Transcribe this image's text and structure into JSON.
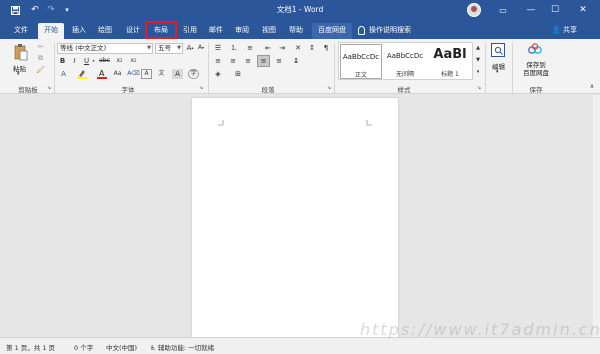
{
  "titlebar": {
    "title": "文档1 - Word",
    "save_icon": "save-icon",
    "undo_icon": "undo-icon",
    "redo_icon": "redo-icon",
    "qat_icon": "customize-qat-icon",
    "window_buttons": [
      "minimize",
      "restore",
      "close"
    ],
    "restore_ribbon_icon": "ribbon-display-icon"
  },
  "tabs": {
    "file": "文件",
    "home": "开始",
    "insert": "插入",
    "draw": "绘图",
    "design": "设计",
    "layout": "布局",
    "references": "引用",
    "mailings": "邮件",
    "review": "审阅",
    "view": "视图",
    "help": "帮助",
    "baidu": "百度网盘",
    "tellme": "操作说明搜索",
    "share": "共享"
  },
  "ribbon": {
    "clipboard": {
      "paste": "粘贴",
      "label": "剪贴板"
    },
    "font": {
      "font_name": "等线 (中文正文)",
      "font_size": "五号",
      "label": "字体",
      "font_color": "#e02020",
      "highlight_color": "#ffff00"
    },
    "paragraph": {
      "label": "段落"
    },
    "styles": {
      "label": "样式",
      "items": [
        {
          "sample": "AaBbCcDc",
          "name": "正文"
        },
        {
          "sample": "AaBbCcDc",
          "name": "无间隔"
        },
        {
          "sample": "AaBl",
          "name": "标题 1"
        }
      ]
    },
    "editing": {
      "label": "编辑"
    },
    "save": {
      "button": "保存到\n百度网盘",
      "line1": "保存到",
      "line2": "百度网盘",
      "label": "保存"
    }
  },
  "statusbar": {
    "page": "第 1 页，共 1 页",
    "words": "0 个字",
    "language": "中文(中国)",
    "accessibility": "辅助功能: 一切就绪"
  },
  "watermark": "https://www.it7admin.cn",
  "colors": {
    "accent": "#2b579a",
    "highlight_border": "#e02020"
  }
}
